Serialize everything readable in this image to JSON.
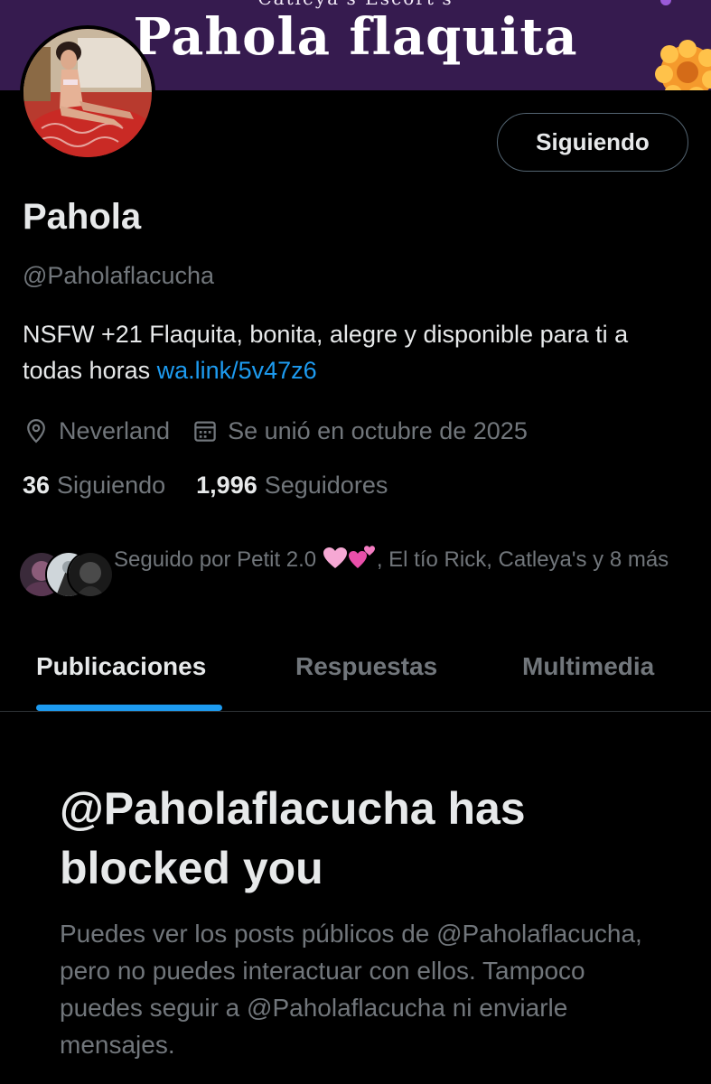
{
  "banner": {
    "top_text": "Catleya's Escort's",
    "title": "Pahola flaquita"
  },
  "profile": {
    "display_name": "Pahola",
    "handle": "@Paholaflacucha",
    "bio_text": "NSFW +21 Flaquita, bonita, alegre y disponible para ti a todas horas ",
    "bio_link": "wa.link/5v47z6",
    "location": "Neverland",
    "joined": "Se unió en octubre de 2025",
    "follow_button_label": "Siguiendo"
  },
  "stats": {
    "following_count": "36",
    "following_label": "Siguiendo",
    "followers_count": "1,996",
    "followers_label": "Seguidores"
  },
  "followed_by": {
    "prefix": "Seguido por Petit 2.0 ",
    "suffix": ", El tío Rick, Catleya's y 8 más"
  },
  "tabs": [
    {
      "label": "Publicaciones",
      "active": true
    },
    {
      "label": "Respuestas",
      "active": false
    },
    {
      "label": "Multimedia",
      "active": false
    }
  ],
  "blocked": {
    "title": "@Paholaflacucha has blocked you",
    "description": "Puedes ver los posts públicos de @Paholaflacucha, pero no puedes interactuar con ellos. Tampoco puedes seguir a @Paholaflacucha ni enviarle mensajes."
  },
  "colors": {
    "background": "#000000",
    "banner": "#361b4f",
    "accent": "#1d9bf0",
    "text_primary": "#e7e9ea",
    "text_secondary": "#71767b"
  },
  "icons": {
    "location": "location-pin-icon",
    "joined": "calendar-icon"
  }
}
